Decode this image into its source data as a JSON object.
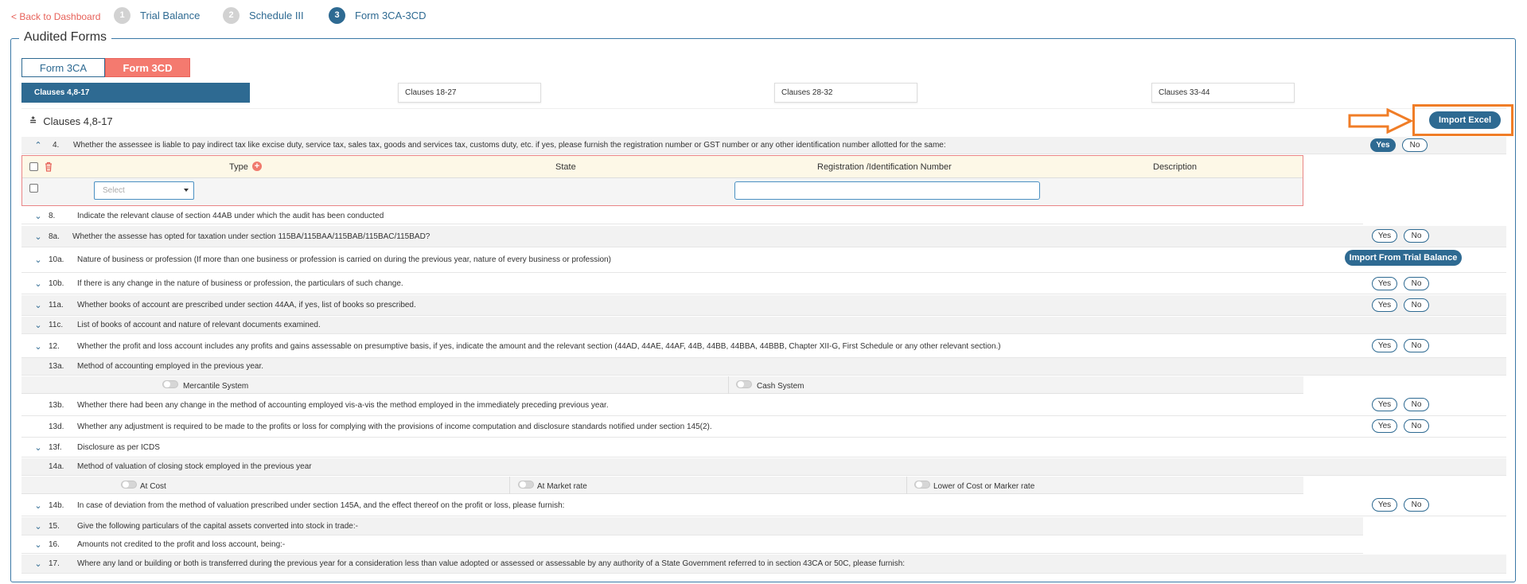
{
  "nav": {
    "back": "< Back to Dashboard",
    "steps": [
      {
        "num": "1",
        "label": "Trial Balance"
      },
      {
        "num": "2",
        "label": "Schedule III"
      },
      {
        "num": "3",
        "label": "Form 3CA-3CD"
      }
    ]
  },
  "legend": "Audited Forms",
  "form_tabs": [
    "Form 3CA",
    "Form 3CD"
  ],
  "clause_tabs": [
    "Clauses 4,8-17",
    "Clauses 18-27",
    "Clauses 28-32",
    "Clauses 33-44"
  ],
  "section_title": "Clauses 4,8-17",
  "buttons": {
    "import_excel": "Import Excel",
    "import_trial": "Import From Trial Balance",
    "yes": "Yes",
    "no": "No"
  },
  "clause4": {
    "num": "4.",
    "text": "Whether the assessee is liable to pay indirect tax like excise duty, service tax, sales tax, goods and services tax, customs duty, etc. if yes, please furnish the registration number or GST number or any other identification number allotted for the same:",
    "headers": [
      "Type",
      "State",
      "Registration /Identification Number",
      "Description"
    ],
    "select_placeholder": "Select"
  },
  "rows": [
    {
      "num": "8.",
      "text": "Indicate the relevant clause of section 44AB under which the audit has been conducted"
    },
    {
      "num": "8a.",
      "text": "Whether the assesse has opted for taxation under section 115BA/115BAA/115BAB/115BAC/115BAD?"
    },
    {
      "num": "10a.",
      "text": "Nature of business or profession (If more than one business or profession is carried on during the previous year, nature of every business or profession)"
    },
    {
      "num": "10b.",
      "text": "If there is any change in the nature of business or profession, the particulars of such change."
    },
    {
      "num": "11a.",
      "text": "Whether books of account are prescribed under section 44AA, if yes, list of books so prescribed."
    },
    {
      "num": "11c.",
      "text": "List of books of account and nature of relevant documents examined."
    },
    {
      "num": "12.",
      "text": "Whether the profit and loss account includes any profits and gains assessable on presumptive basis, if yes, indicate the amount and the relevant section (44AD, 44AE, 44AF, 44B, 44BB, 44BBA, 44BBB, Chapter XII-G, First Schedule or any other relevant section.)"
    },
    {
      "num": "13a.",
      "text": "Method of accounting employed in the previous year."
    },
    {
      "num": "13b.",
      "text": "Whether there had been any change in the method of accounting employed vis-a-vis the method employed in the immediately preceding previous year."
    },
    {
      "num": "13d.",
      "text": "Whether any adjustment is required to be made to the profits or loss for complying with the provisions of income computation and disclosure standards notified under section 145(2)."
    },
    {
      "num": "13f.",
      "text": "Disclosure as per ICDS"
    },
    {
      "num": "14a.",
      "text": "Method of valuation of closing stock employed in the previous year"
    },
    {
      "num": "14b.",
      "text": "In case of deviation from the method of valuation prescribed under section 145A, and the effect thereof on the profit or loss, please furnish:"
    },
    {
      "num": "15.",
      "text": "Give the following particulars of the capital assets converted into stock in trade:-"
    },
    {
      "num": "16.",
      "text": "Amounts not credited to the profit and loss account, being:-"
    },
    {
      "num": "17.",
      "text": "Where any land or building or both is transferred during the previous year for a consideration less than value adopted or assessed or assessable by any authority of a State Government referred to in section 43CA or 50C, please furnish:"
    }
  ],
  "options_13a": [
    "Mercantile System",
    "Cash System"
  ],
  "options_14a": [
    "At Cost",
    "At Market rate",
    "Lower of Cost or Marker rate"
  ]
}
